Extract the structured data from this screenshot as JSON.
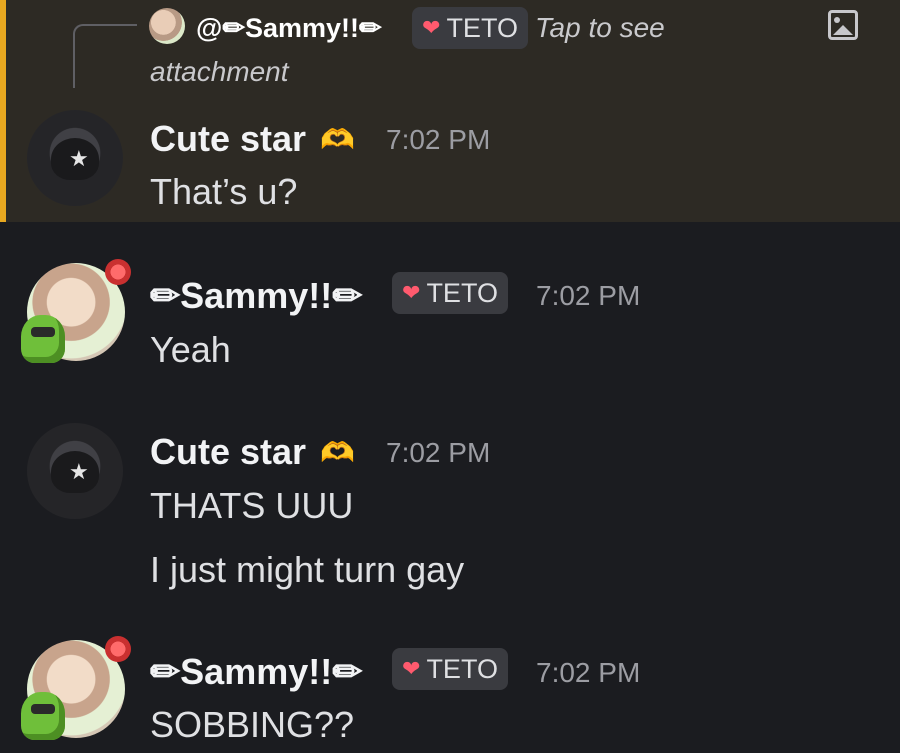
{
  "reply": {
    "username": "@✏Sammy!!✏",
    "tag": "TETO",
    "tap_text": "Tap to see",
    "attachment_text": "attachment"
  },
  "messages": [
    {
      "author": "Cute star",
      "emoji": "🫶",
      "time": "7:02 PM",
      "lines": [
        "That’s u?"
      ]
    },
    {
      "author": "✏Sammy!!✏",
      "tag": "TETO",
      "time": "7:02 PM",
      "lines": [
        "Yeah"
      ]
    },
    {
      "author": "Cute star",
      "emoji": "🫶",
      "time": "7:02 PM",
      "lines": [
        "THATS UUU",
        "I just might turn gay"
      ]
    },
    {
      "author": "✏Sammy!!✏",
      "tag": "TETO",
      "time": "7:02 PM",
      "lines": [
        "SOBBING??"
      ]
    }
  ],
  "colors": {
    "background": "#1b1c20",
    "mention_highlight": "#2d2a24",
    "mention_bar": "#e8a820",
    "tag_background": "#3a3b40"
  },
  "icons": [
    "image-icon",
    "heart-icon",
    "hands-heart-icon",
    "avatar-cute-star",
    "avatar-sammy"
  ]
}
